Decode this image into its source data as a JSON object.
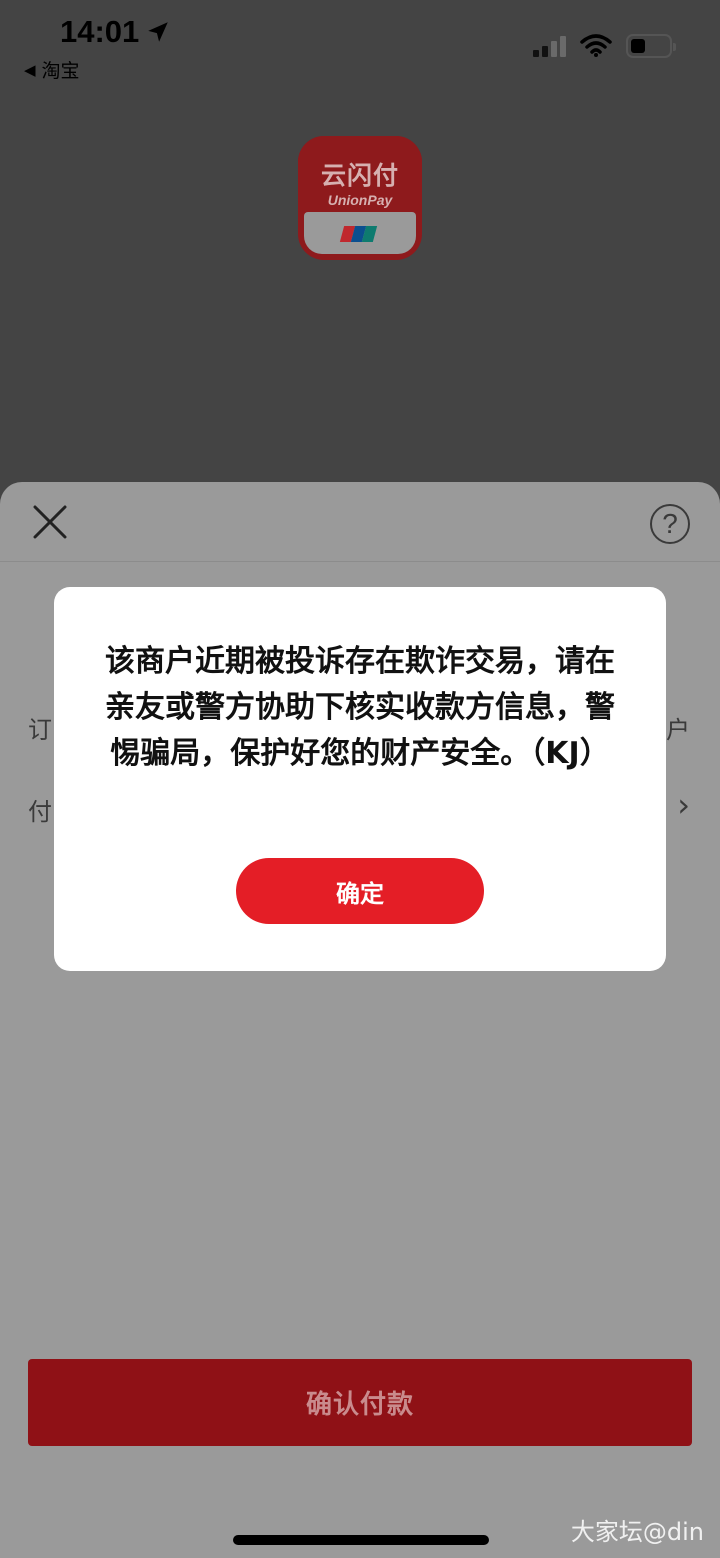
{
  "status_bar": {
    "time": "14:01",
    "back_app": "淘宝"
  },
  "app_logo": {
    "name": "云闪付",
    "subtitle": "UnionPay",
    "stripe_colors": [
      "#c0282e",
      "#0b4f8f",
      "#0e7b6f"
    ]
  },
  "sheet": {
    "close_icon": "close-icon",
    "help_icon": "help-icon",
    "help_glyph": "?",
    "row1_label": "订",
    "row1_right": "户",
    "row2_label": "付",
    "row2_chevron": "›",
    "confirm_button": "确认付款"
  },
  "dialog": {
    "message": "该商户近期被投诉存在欺诈交易，请在亲友或警方协助下核实收款方信息，警惕骗局，保护好您的财产安全。（KJ）",
    "ok_button": "确定"
  },
  "watermark": "大家坛@din",
  "colors": {
    "accent": "#e41e26",
    "confirm_dimmed": "#8f1116",
    "overlay_top": "#444444",
    "sheet_dimmed": "#9a9a9a"
  }
}
